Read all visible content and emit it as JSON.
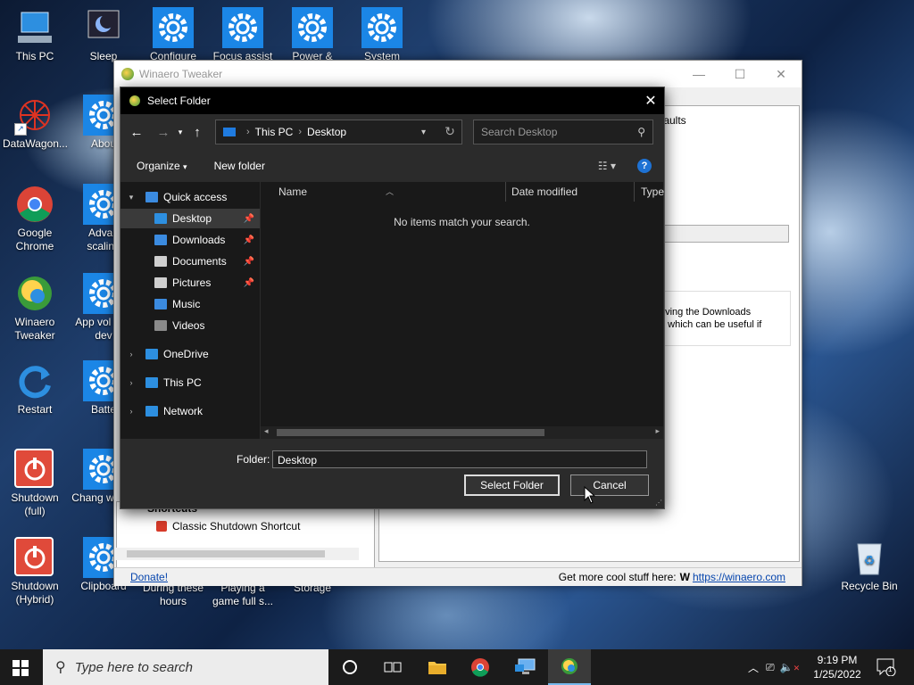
{
  "desktop": {
    "icons_col1": [
      "This PC",
      "DataWagon...",
      "Google Chrome",
      "Winaero Tweaker",
      "Restart",
      "Shutdown (full)",
      "Shutdown (Hybrid)"
    ],
    "icons_col2": [
      "Sleep",
      "Abou",
      "Advan scaling",
      "App vol and dev",
      "Batte",
      "Chang where",
      "Clipboard"
    ],
    "icons_top": [
      "Configure",
      "Focus assist",
      "Power &",
      "System"
    ],
    "icons_bottom": [
      "During these hours",
      "Playing a game full s...",
      "Storage"
    ],
    "recycle_bin": "Recycle Bin"
  },
  "tweaker": {
    "title": "Winaero Tweaker",
    "controls": {
      "minimize": "—",
      "maximize": "☐",
      "close": "✕"
    },
    "defaults_label": "faults",
    "desc_line1": "oving the Downloads",
    "desc_line2": "r, which can be useful if",
    "tree_heading": "Shortcuts",
    "tree_item": "Classic Shutdown Shortcut",
    "status": {
      "donate": "Donate!",
      "more": "Get more cool stuff here:",
      "link": "https://winaero.com"
    }
  },
  "dialog": {
    "title": "Select Folder",
    "close": "✕",
    "address": [
      "This PC",
      "Desktop"
    ],
    "search_placeholder": "Search Desktop",
    "toolbar": {
      "organize": "Organize",
      "new_folder": "New folder",
      "help": "?"
    },
    "nav": [
      {
        "label": "Quick access",
        "kind": "root"
      },
      {
        "label": "Desktop",
        "pinned": true,
        "selected": true
      },
      {
        "label": "Downloads",
        "pinned": true
      },
      {
        "label": "Documents",
        "pinned": true
      },
      {
        "label": "Pictures",
        "pinned": true
      },
      {
        "label": "Music"
      },
      {
        "label": "Videos"
      },
      {
        "label": "OneDrive",
        "kind": "root"
      },
      {
        "label": "This PC",
        "kind": "root"
      },
      {
        "label": "Network",
        "kind": "root"
      }
    ],
    "columns": [
      "Name",
      "Date modified",
      "Type"
    ],
    "empty_message": "No items match your search.",
    "folder_label": "Folder:",
    "folder_value": "Desktop",
    "select_button": "Select Folder",
    "cancel_button": "Cancel"
  },
  "taskbar": {
    "search_placeholder": "Type here to search",
    "time": "9:19 PM",
    "date": "1/25/2022",
    "notifications": "1"
  },
  "colors": {
    "accent": "#1e72d4",
    "taskbar": "#1b1b1b",
    "dialog_bg": "#2b2b2b"
  }
}
